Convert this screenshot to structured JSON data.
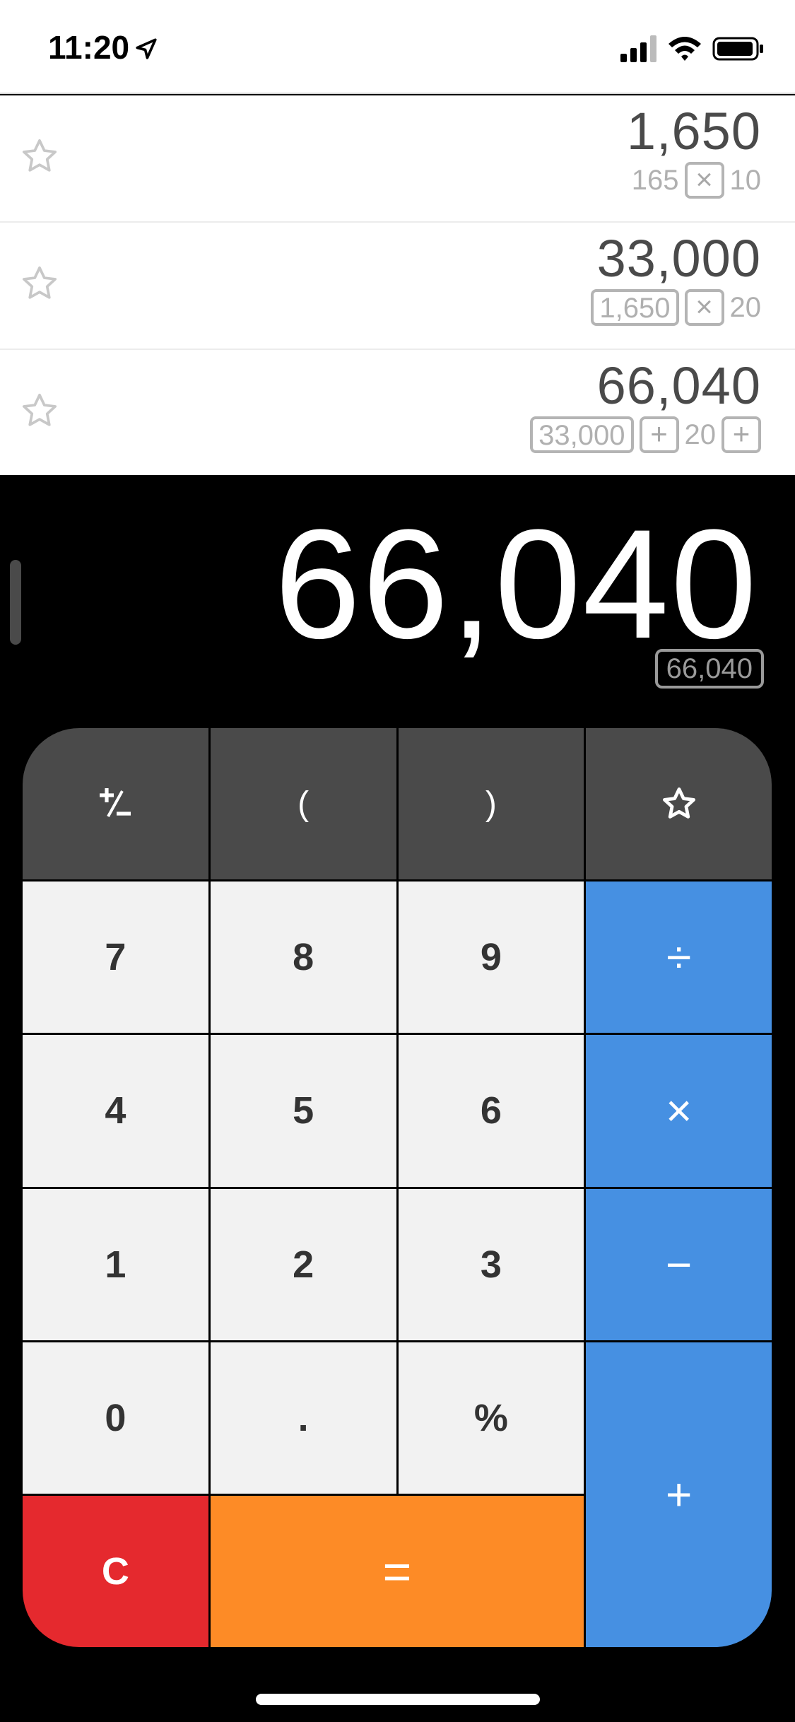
{
  "status_bar": {
    "time": "11:20",
    "icons": [
      "location-arrow-icon",
      "cellular-signal-icon",
      "wifi-icon",
      "battery-icon"
    ]
  },
  "history": [
    {
      "result": "1,650",
      "expression": [
        {
          "type": "plain",
          "text": "165"
        },
        {
          "type": "op",
          "text": "×"
        },
        {
          "type": "plain",
          "text": "10"
        }
      ]
    },
    {
      "result": "33,000",
      "expression": [
        {
          "type": "box",
          "text": "1,650"
        },
        {
          "type": "op",
          "text": "×"
        },
        {
          "type": "plain",
          "text": "20"
        }
      ]
    },
    {
      "result": "66,040",
      "expression": [
        {
          "type": "box",
          "text": "33,000"
        },
        {
          "type": "op",
          "text": "+"
        },
        {
          "type": "plain",
          "text": "20"
        },
        {
          "type": "op",
          "text": "+"
        }
      ]
    }
  ],
  "display": {
    "value": "66,040",
    "expression": "66,040"
  },
  "keys": {
    "plus_minus": "+⁄−",
    "open_paren": "(",
    "close_paren": ")",
    "seven": "7",
    "eight": "8",
    "nine": "9",
    "divide": "÷",
    "four": "4",
    "five": "5",
    "six": "6",
    "multiply": "×",
    "one": "1",
    "two": "2",
    "three": "3",
    "minus": "−",
    "zero": "0",
    "decimal": ".",
    "percent": "%",
    "plus": "+",
    "clear": "C",
    "equals": "="
  },
  "colors": {
    "blue": "#4690e2",
    "orange": "#fd8b26",
    "red": "#e5292e",
    "dark_key": "#4a4a4a",
    "light_key": "#f2f2f2"
  }
}
